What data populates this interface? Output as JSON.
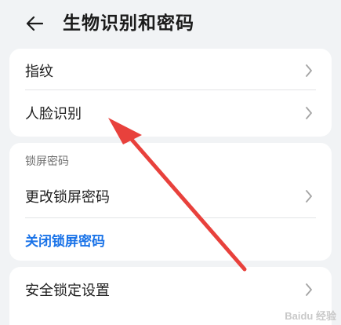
{
  "header": {
    "title": "生物识别和密码",
    "back_icon": "back-arrow-icon"
  },
  "card1": {
    "items": [
      {
        "label": "指纹"
      },
      {
        "label": "人脸识别"
      }
    ]
  },
  "card2": {
    "section_title": "锁屏密码",
    "items": [
      {
        "label": "更改锁屏密码"
      }
    ],
    "link_label": "关闭锁屏密码"
  },
  "card3": {
    "items": [
      {
        "label": "安全锁定设置"
      }
    ]
  },
  "colors": {
    "background": "#f1f3f5",
    "card": "#ffffff",
    "link": "#1a73e8",
    "annotation_arrow": "#e8413c"
  },
  "watermark": {
    "text": "Baidu 经验"
  }
}
